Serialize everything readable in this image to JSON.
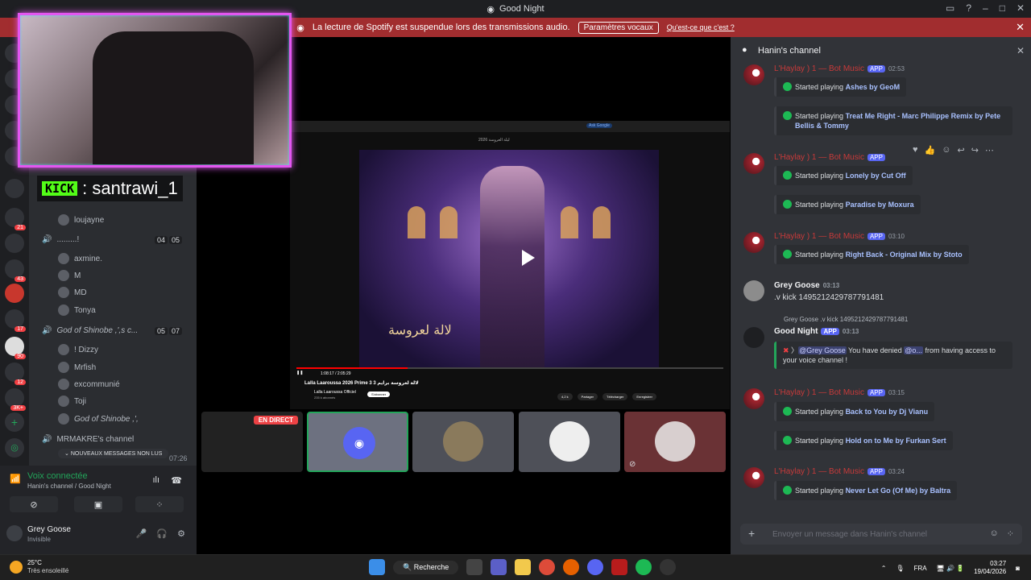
{
  "window": {
    "title": "Good Night"
  },
  "banner": {
    "text": "La lecture de Spotify est suspendue lors des transmissions audio.",
    "button": "Paramètres vocaux",
    "link": "Qu'est-ce que c'est ?"
  },
  "overlay": {
    "kick_logo": "KICK",
    "kick_name": ": santrawi_1"
  },
  "guild_badges": [
    "21",
    "43",
    "17",
    "90",
    "12",
    "3K+"
  ],
  "sidebar": {
    "user_top": "loujayne",
    "channel_dots": ".........!",
    "channel_dots_counts": [
      "04",
      "05"
    ],
    "users_a": [
      "axmine.",
      "M",
      "MD",
      "Tonya"
    ],
    "channel_shinobe": "God of Shinobe ,',s c...",
    "shinobe_counts": [
      "05",
      "07"
    ],
    "users_b": [
      "! Dizzy",
      "Mrfish",
      "excommunié",
      "Toji",
      "God of Shinobe ,',"
    ],
    "channel_mrmakre": "MRMAKRE's channel",
    "new_messages": "NOUVEAUX MESSAGES NON LUS",
    "timer": "07:26"
  },
  "voice": {
    "status": "Voix connectée",
    "location": "Hanin's channel / Good Night"
  },
  "user": {
    "name": "Grey Goose",
    "status": "Invisible"
  },
  "stream": {
    "live": "EN DIRECT",
    "yt_head": "ليلة العروسة 2026",
    "yt_ask": "Ask Google",
    "yt_time": "1:08:17 / 2:05:29",
    "yt_title": "Lalla Laaroussa 2026 Prime 3 لالة لعروسة برايم 3",
    "yt_channel": "Lalla Laaroussa Officiel",
    "yt_subs": "235 k abonnés",
    "yt_subscribe": "S'abonner",
    "yt_likes": "4,2 k",
    "yt_actions": [
      "Partager",
      "Télécharger",
      "Enregistrer"
    ],
    "yt_logo": "لالة لعروسة"
  },
  "chat": {
    "channel": "Hanin's channel",
    "bot_name": "L'Haylay ) 1 — Bot Music",
    "app": "APP",
    "times": [
      "02:53",
      "03:10",
      "03:15",
      "03:24"
    ],
    "started": "Started playing",
    "tracks": [
      "Ashes by GeoM",
      "Treat Me Right - Marc Philippe Remix by Pete Bellis & Tommy",
      "Lonely by Cut Off",
      "Paradise by Moxura",
      "Right Back - Original Mix by Stoto",
      "Back to You by Dj Vianu",
      "Hold on to Me by Furkan Sert",
      "Never Let Go (Of Me) by Baltra"
    ],
    "gg_name": "Grey Goose",
    "gg_time": "03:13",
    "gg_text": ".v kick  1495212429787791481",
    "reply": "Grey Goose .v kick  1495212429787791481",
    "gn_name": "Good Night",
    "gn_time": "03:13",
    "deny_mention1": "@Grey Goose",
    "deny_text1": " You have denied ",
    "deny_mention2": "@o...",
    "deny_text2": " from having access to your voice channel !",
    "composer_placeholder": "Envoyer un message dans Hanin's channel"
  },
  "taskbar": {
    "temp": "25°C",
    "weather": "Très ensoleillé",
    "search": "Recherche",
    "lang": "FRA",
    "time": "03:27",
    "date": "19/04/2026"
  }
}
